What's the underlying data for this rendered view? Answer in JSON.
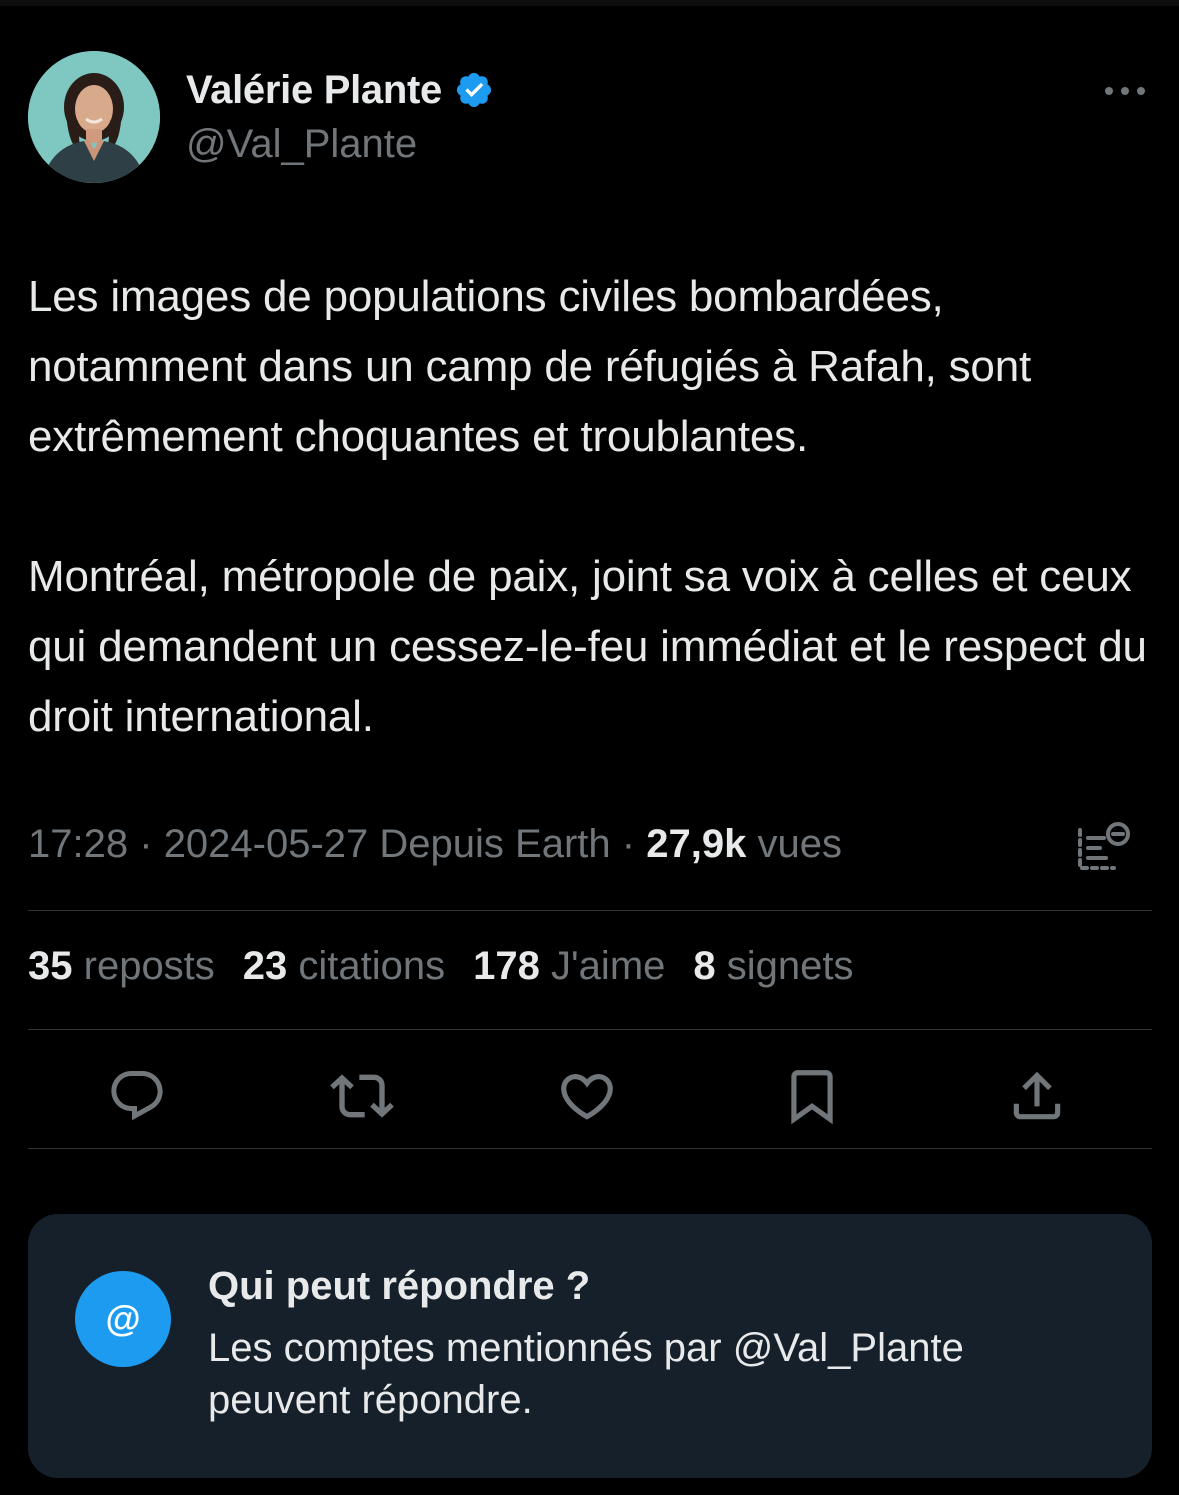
{
  "author": {
    "display_name": "Valérie Plante",
    "handle": "@Val_Plante",
    "verified": true
  },
  "colors": {
    "background": "#000000",
    "text_primary": "#e7e9ea",
    "text_secondary": "#71767b",
    "divider": "#2f3336",
    "accent": "#1d9bf0",
    "card_background": "#16202b"
  },
  "tweet": {
    "paragraph_1": "Les images de populations civiles bombardées, notamment dans un camp de réfugiés à Rafah, sont extrêmement choquantes et troublantes.",
    "paragraph_2": "Montréal, métropole de paix, joint sa voix à celles et ceux qui demandent un cessez-le-feu immédiat et le respect du droit international."
  },
  "meta": {
    "time": "17:28",
    "separator": "·",
    "date": "2024-05-27",
    "source": "Depuis Earth",
    "views_count": "27,9k",
    "views_label": "vues"
  },
  "stats": [
    {
      "count": "35",
      "label": "reposts"
    },
    {
      "count": "23",
      "label": "citations"
    },
    {
      "count": "178",
      "label": "J'aime"
    },
    {
      "count": "8",
      "label": "signets"
    }
  ],
  "actions": [
    {
      "name": "reply",
      "icon": "reply-icon"
    },
    {
      "name": "repost",
      "icon": "repost-icon"
    },
    {
      "name": "like",
      "icon": "heart-icon"
    },
    {
      "name": "bookmark",
      "icon": "bookmark-icon"
    },
    {
      "name": "share",
      "icon": "share-icon"
    }
  ],
  "reply_restriction": {
    "badge": "@",
    "title": "Qui peut répondre ?",
    "description": "Les comptes mentionnés par @Val_Plante peuvent répondre."
  }
}
